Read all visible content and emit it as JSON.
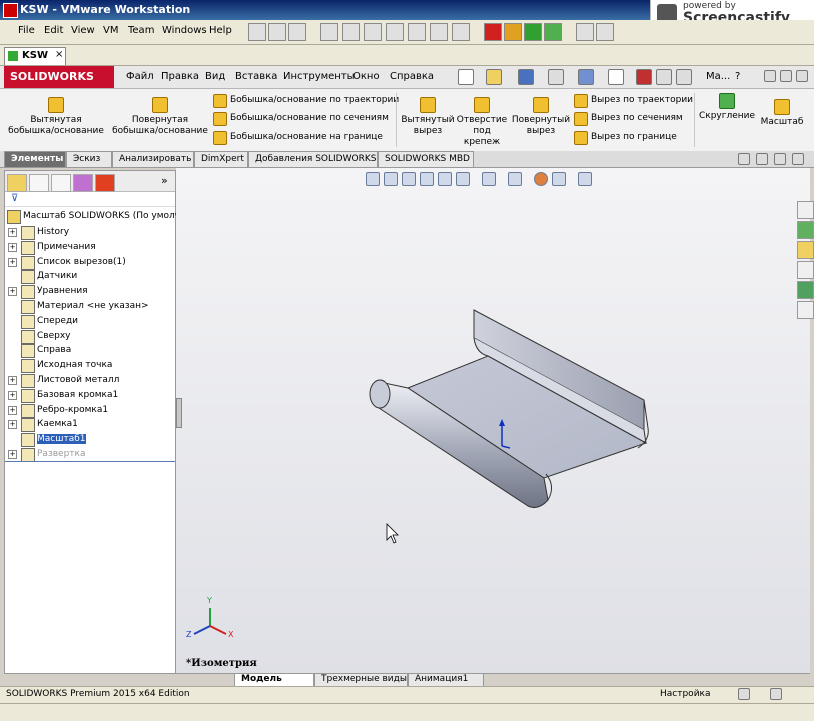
{
  "vmware": {
    "title": "KSW - VMware Workstation",
    "menu": [
      "File",
      "Edit",
      "View",
      "VM",
      "Team",
      "Windows",
      "Help"
    ],
    "tab": "KSW"
  },
  "screencastify": {
    "powered": "powered by",
    "name": "Screencastify Lite"
  },
  "sw": {
    "logo": "SOLIDWORKS",
    "menu": [
      "Файл",
      "Правка",
      "Вид",
      "Вставка",
      "Инструменты",
      "Окно",
      "Справка"
    ],
    "right_menu": "Ма..."
  },
  "commands": {
    "extrude_boss": "Вытянутая бобышка/основание",
    "revolve_boss": "Повернутая бобышка/основание",
    "sweep_boss": "Бобышка/основание по траектории",
    "loft_boss": "Бобышка/основание по сечениям",
    "boundary_boss": "Бобышка/основание на границе",
    "extrude_cut": "Вытянутый вырез",
    "hole_wizard": "Отверстие под крепеж",
    "revolve_cut": "Повернутый вырез",
    "sweep_cut": "Вырез по траектории",
    "loft_cut": "Вырез по сечениям",
    "boundary_cut": "Вырез по границе",
    "fillet": "Скругление",
    "scale": "Масштаб"
  },
  "cm_tabs": [
    "Элементы",
    "Эскиз",
    "Анализировать",
    "DimXpert",
    "Добавления SOLIDWORKS",
    "SOLIDWORKS MBD"
  ],
  "tree": {
    "root": "Масштаб SOLIDWORKS  (По умолчан",
    "items": [
      {
        "label": "History",
        "expandable": true
      },
      {
        "label": "Примечания",
        "expandable": true
      },
      {
        "label": "Список вырезов(1)",
        "expandable": true
      },
      {
        "label": "Датчики",
        "expandable": false
      },
      {
        "label": "Уравнения",
        "expandable": true
      },
      {
        "label": "Материал <не указан>",
        "expandable": false
      },
      {
        "label": "Спереди",
        "expandable": false
      },
      {
        "label": "Сверху",
        "expandable": false
      },
      {
        "label": "Справа",
        "expandable": false
      },
      {
        "label": "Исходная точка",
        "expandable": false
      },
      {
        "label": "Листовой металл",
        "expandable": true
      },
      {
        "label": "Базовая кромка1",
        "expandable": true
      },
      {
        "label": "Ребро-кромка1",
        "expandable": true
      },
      {
        "label": "Каемка1",
        "expandable": true
      },
      {
        "label": "Масштаб1",
        "expandable": false
      },
      {
        "label": "Развертка",
        "expandable": true
      }
    ]
  },
  "viewport": {
    "view_name": "*Изометрия",
    "triad": {
      "x": "X",
      "y": "Y",
      "z": "Z"
    }
  },
  "bottom_tabs": [
    "Модель",
    "Трехмерные виды",
    "Анимация1"
  ],
  "status": {
    "edition": "SOLIDWORKS Premium 2015 x64 Edition",
    "customize": "Настройка"
  }
}
